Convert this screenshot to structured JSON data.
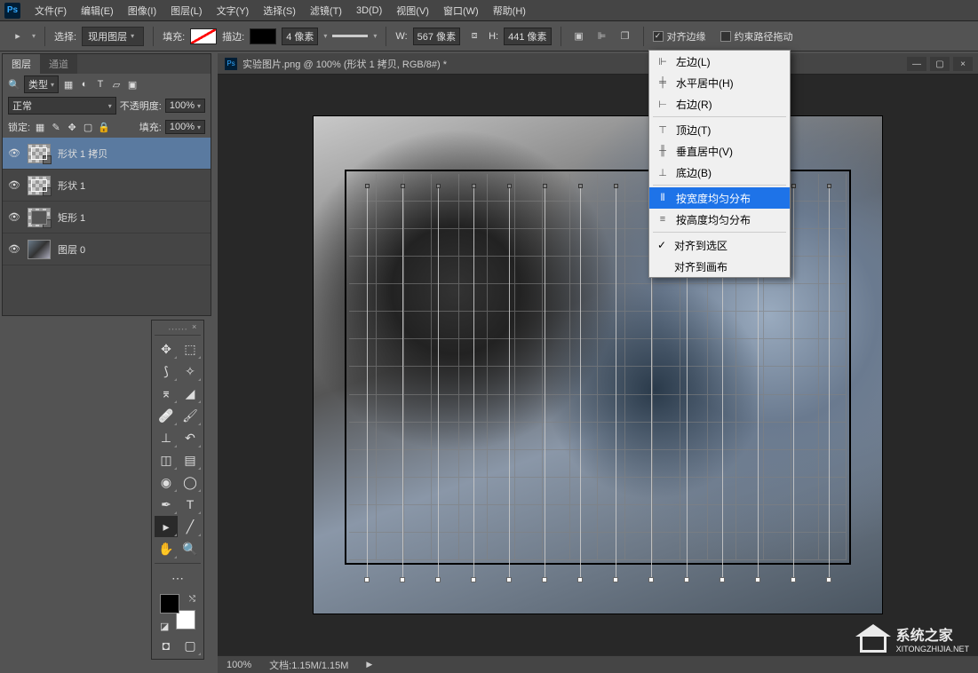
{
  "menubar": {
    "items": [
      "文件(F)",
      "编辑(E)",
      "图像(I)",
      "图层(L)",
      "文字(Y)",
      "选择(S)",
      "滤镜(T)",
      "3D(D)",
      "视图(V)",
      "窗口(W)",
      "帮助(H)"
    ]
  },
  "optionsbar": {
    "select_label": "选择:",
    "select_value": "现用图层",
    "fill_label": "填充:",
    "stroke_label": "描边:",
    "stroke_width": "4 像素",
    "w_label": "W:",
    "w_value": "567 像素",
    "h_label": "H:",
    "h_value": "441 像素",
    "align_edges_label": "对齐边缘",
    "constrain_path_label": "约束路径拖动"
  },
  "doc_tab": {
    "title": "实验图片.png @ 100% (形状 1 拷贝, RGB/8#) *"
  },
  "layers_panel": {
    "tabs": [
      "图层",
      "通道"
    ],
    "kind_label": "类型",
    "blend_mode": "正常",
    "opacity_label": "不透明度:",
    "opacity_value": "100%",
    "lock_label": "锁定:",
    "fill_label": "填充:",
    "fill_value": "100%",
    "layers": [
      {
        "name": "形状 1 拷贝",
        "kind": "shape"
      },
      {
        "name": "形状 1",
        "kind": "shape"
      },
      {
        "name": "矩形 1",
        "kind": "rect"
      },
      {
        "name": "图层 0",
        "kind": "img"
      }
    ]
  },
  "align_menu": {
    "items": [
      {
        "label": "左边(L)",
        "icon": "⊩"
      },
      {
        "label": "水平居中(H)",
        "icon": "╪"
      },
      {
        "label": "右边(R)",
        "icon": "⊢"
      }
    ],
    "items2": [
      {
        "label": "顶边(T)",
        "icon": "⊤"
      },
      {
        "label": "垂直居中(V)",
        "icon": "╫"
      },
      {
        "label": "底边(B)",
        "icon": "⊥"
      }
    ],
    "items3": [
      {
        "label": "按宽度均匀分布",
        "icon": "⫴",
        "highlighted": true
      },
      {
        "label": "按高度均匀分布",
        "icon": "≡"
      }
    ],
    "items4": [
      {
        "label": "对齐到选区",
        "checked": true
      },
      {
        "label": "对齐到画布"
      }
    ]
  },
  "statusbar": {
    "zoom": "100%",
    "doc_info": "文档:1.15M/1.15M"
  },
  "watermark": {
    "title": "系统之家",
    "url": "XITONGZHIJIA.NET"
  }
}
